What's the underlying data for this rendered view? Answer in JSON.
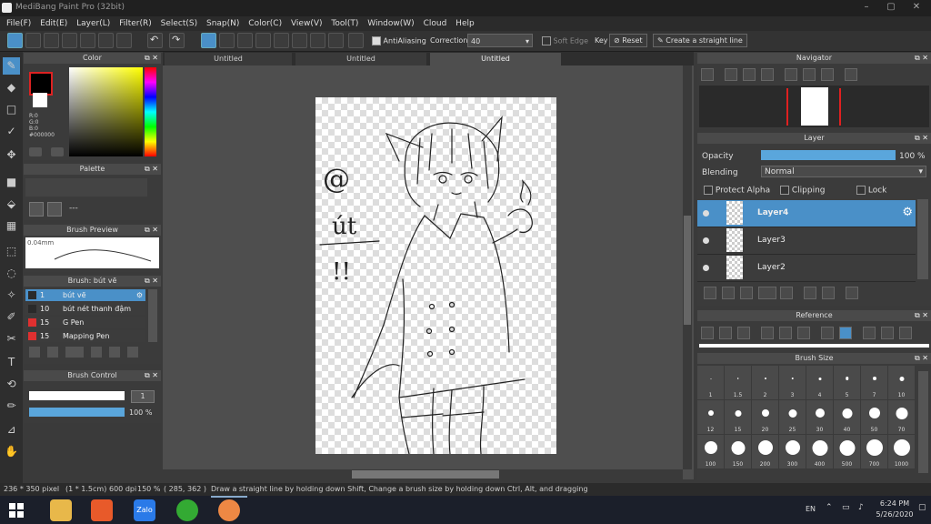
{
  "window": {
    "title": "MediBang Paint Pro (32bit)"
  },
  "menu": [
    "File(F)",
    "Edit(E)",
    "Layer(L)",
    "Filter(R)",
    "Select(S)",
    "Snap(N)",
    "Color(C)",
    "View(V)",
    "Tool(T)",
    "Window(W)",
    "Cloud",
    "Help"
  ],
  "toolbar": {
    "antialiasing": "AntiAliasing",
    "correction_label": "Correction",
    "correction_value": "40",
    "soft_edge": "Soft Edge",
    "key": "Key",
    "reset": "Reset",
    "straight_line": "Create a straight line"
  },
  "color_panel": {
    "title": "Color",
    "r": "R:0",
    "g": "G:0",
    "b": "B:0",
    "hex": "#000000",
    "fg": "#000000",
    "bg": "#ffffff"
  },
  "palette_panel": {
    "title": "Palette",
    "empty": "---"
  },
  "brush_preview": {
    "title": "Brush Preview",
    "size": "0.04mm"
  },
  "brush_list": {
    "title": "Brush: bút vẽ",
    "items": [
      {
        "size": "1",
        "name": "bút vẽ",
        "color": "#2a2a2a"
      },
      {
        "size": "10",
        "name": "bút nét thanh đậm",
        "color": "#2a2a2a"
      },
      {
        "size": "15",
        "name": "G Pen",
        "color": "#e03030"
      },
      {
        "size": "15",
        "name": "Mapping Pen",
        "color": "#e03030"
      }
    ]
  },
  "brush_control": {
    "title": "Brush Control",
    "size_value": "1",
    "opacity": "100 %",
    "opacity_level": 1.0
  },
  "tabs": [
    "Untitled",
    "Untitled",
    "Untitled"
  ],
  "navigator": {
    "title": "Navigator"
  },
  "layer_panel": {
    "title": "Layer",
    "opacity_label": "Opacity",
    "opacity_value": "100 %",
    "opacity_level": 1.0,
    "blending_label": "Blending",
    "blending_value": "Normal",
    "protect_alpha": "Protect Alpha",
    "clipping": "Clipping",
    "lock": "Lock",
    "layers": [
      "Layer4",
      "Layer3",
      "Layer2"
    ]
  },
  "reference": {
    "title": "Reference"
  },
  "brush_size": {
    "title": "Brush Size",
    "sizes": [
      "1",
      "1.5",
      "2",
      "3",
      "4",
      "5",
      "7",
      "10",
      "12",
      "15",
      "20",
      "25",
      "30",
      "40",
      "50",
      "70",
      "100",
      "150",
      "200",
      "300",
      "400",
      "500",
      "700",
      "1000"
    ]
  },
  "canvas": {
    "text_1": "@",
    "text_2": "út",
    "text_3": "!!"
  },
  "status": {
    "dims": "236 * 350 pixel",
    "cm": "(1 * 1.5cm)",
    "dpi": "600 dpi",
    "zoom": "150 %",
    "coords": "( 285, 362 )",
    "hint": "Draw a straight line by holding down Shift, Change a brush size by holding down Ctrl, Alt, and dragging"
  },
  "taskbar": {
    "lang": "EN",
    "time": "6:24 PM",
    "date": "5/26/2020",
    "zalo": "Zalo"
  }
}
